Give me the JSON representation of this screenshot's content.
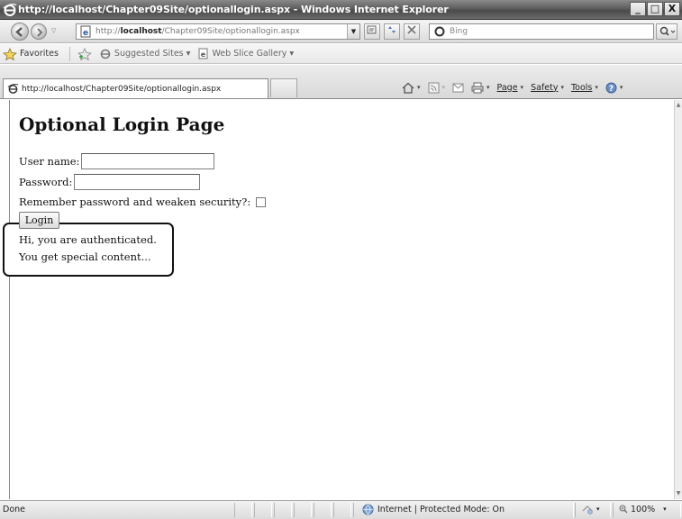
{
  "window": {
    "title": "http://localhost/Chapter09Site/optionallogin.aspx - Windows Internet Explorer",
    "minimize": "_",
    "maximize": "□",
    "close": "X"
  },
  "addressbar": {
    "url_prefix": "http://",
    "url_host": "localhost",
    "url_path": "/Chapter09Site/optionallogin.aspx",
    "search_placeholder": "Bing"
  },
  "favorites": {
    "label": "Favorites",
    "items": [
      "Suggested Sites ▾",
      "Web Slice Gallery ▾"
    ]
  },
  "tab": {
    "title": "http://localhost/Chapter09Site/optionallogin.aspx"
  },
  "commands": {
    "page": "Page",
    "safety": "Safety",
    "tools": "Tools"
  },
  "page": {
    "heading": "Optional Login Page",
    "username_label": "User name:",
    "password_label": "Password:",
    "remember_label": "Remember password and weaken security?:",
    "login_button": "Login",
    "message_line1": "Hi, you are authenticated.",
    "message_line2": "You get special content..."
  },
  "status": {
    "text": "Done",
    "zone": "Internet | Protected Mode: On",
    "zoom": "100%"
  },
  "colors": {
    "titlebar": "#5e5e5e",
    "chrome": "#dcdcdc"
  },
  "icons": [
    "ie-icon",
    "back-icon",
    "forward-icon",
    "page-icon",
    "refresh-icon",
    "stop-icon",
    "bing-icon",
    "search-icon",
    "star-icon",
    "add-favorite-icon",
    "home-icon",
    "feeds-icon",
    "mail-icon",
    "print-icon",
    "help-icon",
    "globe-icon"
  ]
}
